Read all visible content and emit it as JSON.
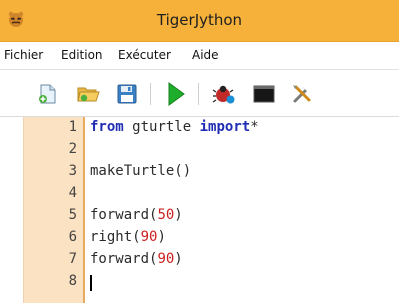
{
  "window": {
    "title": "TigerJython"
  },
  "menubar": {
    "items": [
      "Fichier",
      "Edition",
      "Exécuter",
      "Aide"
    ]
  },
  "toolbar": {
    "buttons": [
      {
        "name": "new-file",
        "icon": "new-file-icon"
      },
      {
        "name": "open-file",
        "icon": "folder-icon"
      },
      {
        "name": "save",
        "icon": "floppy-icon"
      },
      {
        "name": "run",
        "icon": "play-icon"
      },
      {
        "name": "debug",
        "icon": "bug-icon"
      },
      {
        "name": "console",
        "icon": "terminal-icon"
      },
      {
        "name": "settings",
        "icon": "tools-icon"
      }
    ]
  },
  "editor": {
    "line_numbers": [
      "1",
      "2",
      "3",
      "4",
      "5",
      "6",
      "7",
      "8"
    ],
    "lines": [
      {
        "parts": [
          {
            "t": "from",
            "c": "kw"
          },
          {
            "t": " ",
            "c": "plain"
          },
          {
            "t": "gturtle",
            "c": "plain"
          },
          {
            "t": " ",
            "c": "plain"
          },
          {
            "t": "import",
            "c": "kw"
          },
          {
            "t": "*",
            "c": "plain"
          }
        ]
      },
      {
        "parts": []
      },
      {
        "parts": [
          {
            "t": "makeTurtle()",
            "c": "plain"
          }
        ]
      },
      {
        "parts": []
      },
      {
        "parts": [
          {
            "t": "forward(",
            "c": "plain"
          },
          {
            "t": "50",
            "c": "num"
          },
          {
            "t": ")",
            "c": "plain"
          }
        ]
      },
      {
        "parts": [
          {
            "t": "right(",
            "c": "plain"
          },
          {
            "t": "90",
            "c": "num"
          },
          {
            "t": ")",
            "c": "plain"
          }
        ]
      },
      {
        "parts": [
          {
            "t": "forward(",
            "c": "plain"
          },
          {
            "t": "90",
            "c": "num"
          },
          {
            "t": ")",
            "c": "plain"
          }
        ]
      },
      {
        "parts": []
      }
    ],
    "cursor_line": 8
  },
  "colors": {
    "titlebar": "#f6b13a",
    "gutter": "#fbe2c2",
    "keyword": "#1f2db3",
    "number": "#cc1f1f"
  }
}
